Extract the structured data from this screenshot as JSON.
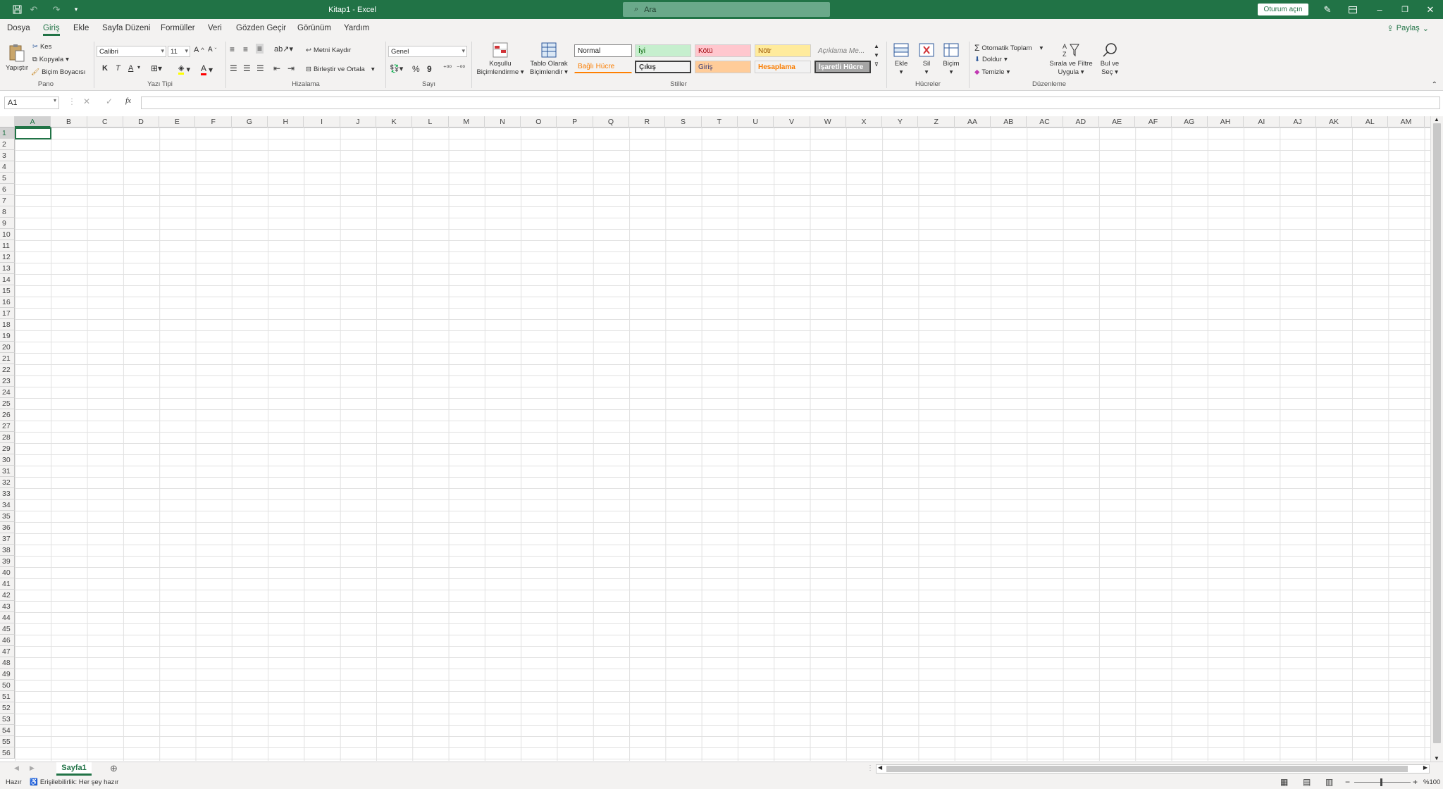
{
  "title": "Kitap1 - Excel",
  "search_placeholder": "Ara",
  "signin": "Oturum açın",
  "tabs": [
    "Dosya",
    "Giriş",
    "Ekle",
    "Sayfa Düzeni",
    "Formüller",
    "Veri",
    "Gözden Geçir",
    "Görünüm",
    "Yardım"
  ],
  "share": "Paylaş",
  "clipboard": {
    "paste": "Yapıştır",
    "cut": "Kes",
    "copy": "Kopyala",
    "format_painter": "Biçim Boyacısı",
    "label": "Pano"
  },
  "font": {
    "name": "Calibri",
    "size": "11",
    "bold": "K",
    "italic": "T",
    "underline": "A",
    "label": "Yazı Tipi"
  },
  "alignment": {
    "wrap": "Metni Kaydır",
    "merge": "Birleştir ve Ortala",
    "label": "Hizalama"
  },
  "number": {
    "format": "Genel",
    "label": "Sayı"
  },
  "styles": {
    "conditional": "Koşullu Biçimlendirme",
    "as_table": "Tablo Olarak Biçimlendir",
    "label": "Stiller",
    "cells": [
      "Normal",
      "İyi",
      "Kötü",
      "Nötr",
      "Açıklama Me...",
      "Bağlı Hücre",
      "Çıkış",
      "Giriş",
      "Hesaplama",
      "İşaretli Hücre"
    ]
  },
  "cells_group": {
    "insert": "Ekle",
    "delete": "Sil",
    "format": "Biçim",
    "label": "Hücreler"
  },
  "editing": {
    "autosum": "Otomatik Toplam",
    "fill": "Doldur",
    "clear": "Temizle",
    "sort": "Sırala ve Filtre Uygula",
    "find": "Bul ve Seç",
    "label": "Düzenleme"
  },
  "namebox": "A1",
  "fx": "fx",
  "columns": [
    "A",
    "B",
    "C",
    "D",
    "E",
    "F",
    "G",
    "H",
    "I",
    "J",
    "K",
    "L",
    "M",
    "N",
    "O",
    "P",
    "Q",
    "R",
    "S",
    "T",
    "U",
    "V",
    "W",
    "X",
    "Y",
    "Z",
    "AA",
    "AB",
    "AC",
    "AD",
    "AE",
    "AF",
    "AG",
    "AH",
    "AI",
    "AJ",
    "AK",
    "AL",
    "AM"
  ],
  "row_count": 56,
  "sheet": "Sayfa1",
  "status": {
    "ready": "Hazır",
    "accessibility": "Erişilebilirlik: Her şey hazır",
    "zoom": "%100"
  }
}
